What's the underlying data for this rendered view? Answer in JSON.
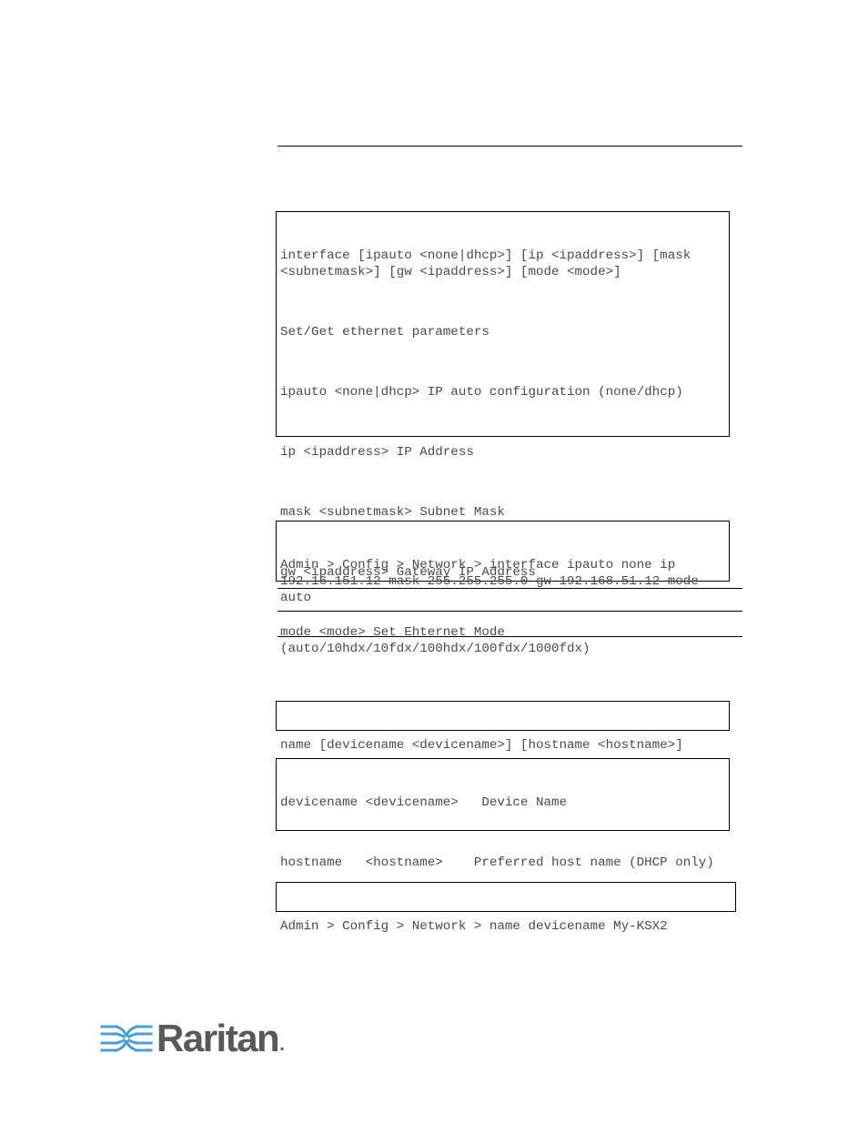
{
  "interface_syntax": {
    "lines": [
      "interface [ipauto <none|dhcp>] [ip <ipaddress>] [mask <subnetmask>] [gw <ipaddress>] [mode <mode>]",
      "Set/Get ethernet parameters",
      "ipauto <none|dhcp> IP auto configuration (none/dhcp)",
      "ip <ipaddress> IP Address",
      "mask <subnetmask> Subnet Mask",
      "gw <ipaddress> Gateway IP Address",
      "mode <mode> Set Ehternet Mode (auto/10hdx/10fdx/100hdx/100fdx/1000fdx)"
    ]
  },
  "interface_example": {
    "text": "Admin > Config > Network > interface ipauto none ip 192.16.151.12 mask 255.255.255.0 gw 192.168.51.12 mode auto"
  },
  "name_syntax": {
    "text": "name [devicename <devicename>] [hostname <hostname>]"
  },
  "name_params": {
    "lines": [
      "devicename <devicename>   Device Name",
      "hostname   <hostname>    Preferred host name (DHCP only)"
    ]
  },
  "name_example": {
    "text": "Admin > Config > Network > name devicename My-KSX2"
  },
  "footer": {
    "logo_text": "Raritan",
    "logo_dot": ".",
    "brand_blue": "#4a9fd6",
    "brand_gray": "#58595b"
  }
}
